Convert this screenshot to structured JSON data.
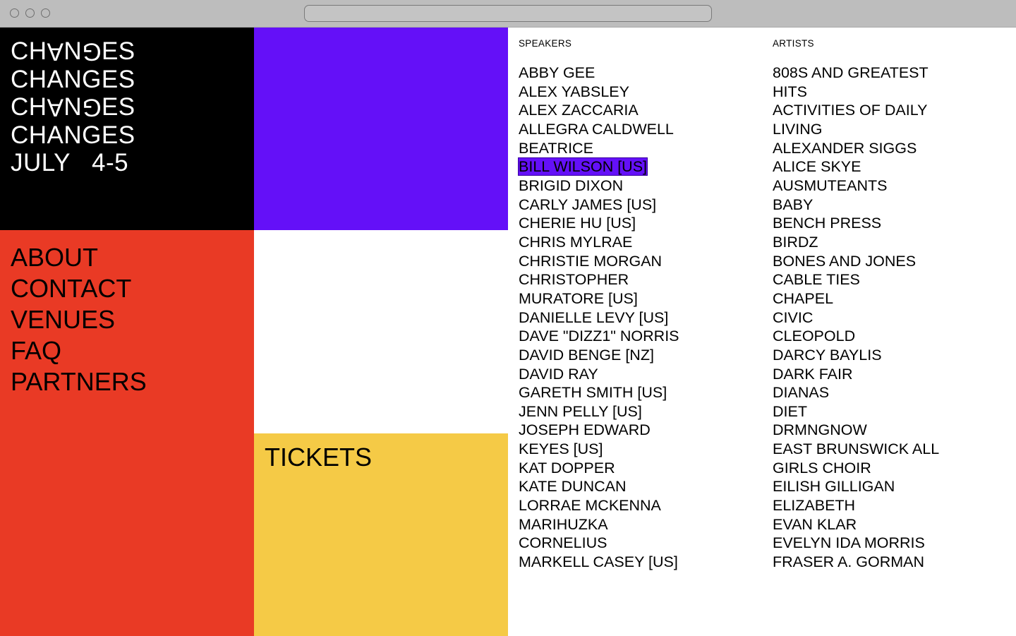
{
  "colors": {
    "black": "#000000",
    "purple": "#6410f8",
    "red": "#e93a25",
    "yellow": "#f5ca46",
    "white": "#ffffff"
  },
  "browser": {
    "controls": [
      "close-icon",
      "minimize-icon",
      "maximize-icon"
    ],
    "url": ""
  },
  "logo": {
    "lines": [
      "CHANGES",
      "CHANGES",
      "CHANGES",
      "CHANGES"
    ],
    "date": "JULY   4-5"
  },
  "nav": {
    "items": [
      "ABOUT",
      "CONTACT",
      "VENUES",
      "FAQ",
      "PARTNERS"
    ]
  },
  "tickets": {
    "label": "TICKETS"
  },
  "speakers": {
    "heading": "SPEAKERS",
    "highlighted": "BILL WILSON [US]",
    "items": [
      "ABBY GEE",
      "ALEX YABSLEY",
      "ALEX ZACCARIA",
      "ALLEGRA CALDWELL",
      "BEATRICE",
      "BILL WILSON [US]",
      "BRIGID DIXON",
      "CARLY JAMES [US]",
      "CHERIE HU [US]",
      "CHRIS MYLRAE",
      "CHRISTIE MORGAN",
      "CHRISTOPHER",
      "MURATORE [US]",
      "DANIELLE LEVY [US]",
      "DAVE \"DIZZ1\" NORRIS",
      "DAVID BENGE [NZ]",
      "DAVID RAY",
      "GARETH SMITH [US]",
      "JENN PELLY [US]",
      "JOSEPH EDWARD",
      "KEYES [US]",
      "KAT DOPPER",
      "KATE DUNCAN",
      "LORRAE MCKENNA",
      "MARIHUZKA",
      "CORNELIUS",
      "MARKELL CASEY [US]"
    ]
  },
  "artists": {
    "heading": "ARTISTS",
    "items": [
      "808S AND GREATEST",
      "HITS",
      "ACTIVITIES OF DAILY",
      "LIVING",
      "ALEXANDER SIGGS",
      "ALICE SKYE",
      "AUSMUTEANTS",
      "BABY",
      "BENCH PRESS",
      "BIRDZ",
      "BONES AND JONES",
      "CABLE TIES",
      "CHAPEL",
      "CIVIC",
      "CLEOPOLD",
      "DARCY BAYLIS",
      "DARK FAIR",
      "DIANAS",
      "DIET",
      "DRMNGNOW",
      "EAST BRUNSWICK ALL",
      "GIRLS CHOIR",
      "EILISH GILLIGAN",
      "ELIZABETH",
      "EVAN KLAR",
      "EVELYN IDA MORRIS",
      "FRASER A. GORMAN"
    ]
  }
}
